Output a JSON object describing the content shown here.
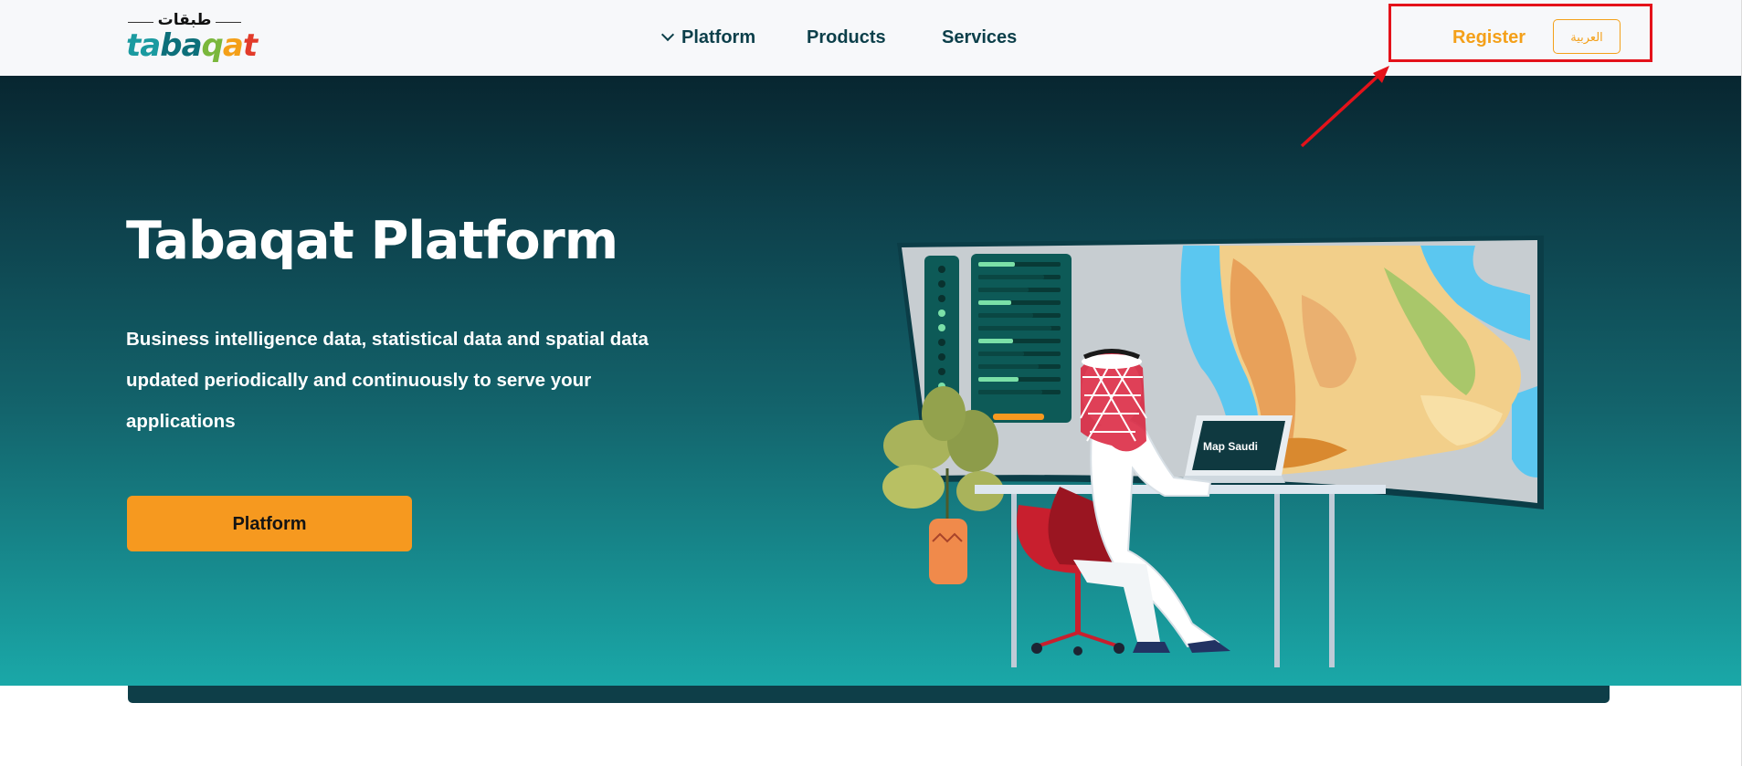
{
  "header": {
    "logo_arabic": "طبقات",
    "logo_letters": [
      {
        "ch": "t",
        "color": "#1a9aa0"
      },
      {
        "ch": "a",
        "color": "#1a9aa0"
      },
      {
        "ch": "b",
        "color": "#0d6f7a"
      },
      {
        "ch": "a",
        "color": "#0d6f7a"
      },
      {
        "ch": "q",
        "color": "#7ab73c"
      },
      {
        "ch": "a",
        "color": "#f4a019"
      },
      {
        "ch": "t",
        "color": "#e23b2a"
      }
    ],
    "nav": [
      {
        "label": "Platform",
        "has_dropdown": true,
        "icon": "chevron-down-icon"
      },
      {
        "label": "Products",
        "has_dropdown": false
      },
      {
        "label": "Services",
        "has_dropdown": false
      }
    ],
    "register_label": "Register",
    "language_button": "العربية"
  },
  "hero": {
    "title": "Tabaqat Platform",
    "description": "Business intelligence data, statistical data and spatial data updated periodically and continuously to serve your applications",
    "cta_label": "Platform",
    "laptop_text": "Map Saudi"
  },
  "colors": {
    "accent_orange": "#f6991f",
    "nav_text": "#0c3f4a",
    "hero_top": "#082630",
    "hero_bottom": "#1aa8a8",
    "annotation_red": "#e4121a"
  }
}
